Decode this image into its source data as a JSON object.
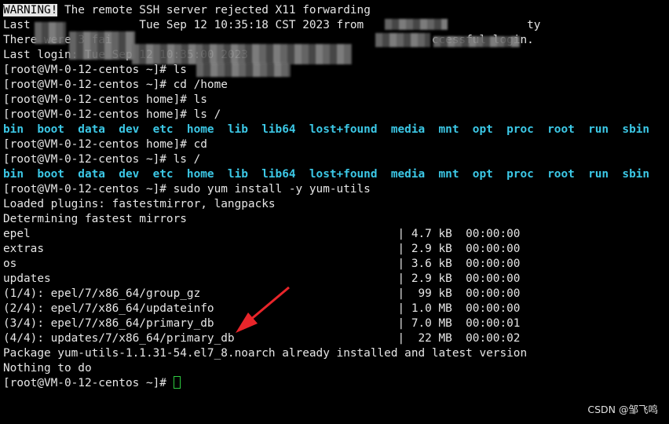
{
  "terminal": {
    "lines": [
      {
        "segments": [
          {
            "text": "WARNING!",
            "style": "warn"
          },
          {
            "text": " The remote SSH server rejected X11 forwarding",
            "style": "plain"
          }
        ]
      },
      {
        "segments": [
          {
            "text": "Last                Tue Sep 12 10:35:18 CST 2023 from                        ty",
            "style": "plain"
          }
        ]
      },
      {
        "segments": [
          {
            "text": "There were 3 fai                                               ccessful login.",
            "style": "plain"
          }
        ]
      },
      {
        "segments": [
          {
            "text": "Last login: Tue Sep 12 10:35:00 2023",
            "style": "plain"
          }
        ]
      },
      {
        "segments": [
          {
            "text": "[root@VM-0-12-centos ~]# ls",
            "style": "plain"
          }
        ]
      },
      {
        "segments": [
          {
            "text": "[root@VM-0-12-centos ~]# cd /home",
            "style": "plain"
          }
        ]
      },
      {
        "segments": [
          {
            "text": "[root@VM-0-12-centos home]# ls",
            "style": "plain"
          }
        ]
      },
      {
        "segments": [
          {
            "text": "[root@VM-0-12-centos home]# ls /",
            "style": "plain"
          }
        ]
      },
      {
        "segments": [
          {
            "text": "bin  boot  data  dev  etc  home  lib  lib64  lost+found  media  mnt  opt  proc  root  run  sbin",
            "style": "dir"
          }
        ]
      },
      {
        "segments": [
          {
            "text": "[root@VM-0-12-centos home]# cd",
            "style": "plain"
          }
        ]
      },
      {
        "segments": [
          {
            "text": "[root@VM-0-12-centos ~]# ls /",
            "style": "plain"
          }
        ]
      },
      {
        "segments": [
          {
            "text": "bin  boot  data  dev  etc  home  lib  lib64  lost+found  media  mnt  opt  proc  root  run  sbin",
            "style": "dir"
          }
        ]
      },
      {
        "segments": [
          {
            "text": "[root@VM-0-12-centos ~]# sudo yum install -y yum-utils",
            "style": "plain"
          }
        ]
      },
      {
        "segments": [
          {
            "text": "Loaded plugins: fastestmirror, langpacks",
            "style": "plain"
          }
        ]
      },
      {
        "segments": [
          {
            "text": "Determining fastest mirrors",
            "style": "plain"
          }
        ]
      },
      {
        "segments": [
          {
            "text": "epel                                                      | 4.7 kB  00:00:00",
            "style": "plain"
          }
        ]
      },
      {
        "segments": [
          {
            "text": "extras                                                    | 2.9 kB  00:00:00",
            "style": "plain"
          }
        ]
      },
      {
        "segments": [
          {
            "text": "os                                                        | 3.6 kB  00:00:00",
            "style": "plain"
          }
        ]
      },
      {
        "segments": [
          {
            "text": "updates                                                   | 2.9 kB  00:00:00",
            "style": "plain"
          }
        ]
      },
      {
        "segments": [
          {
            "text": "(1/4): epel/7/x86_64/group_gz                             |  99 kB  00:00:00",
            "style": "plain"
          }
        ]
      },
      {
        "segments": [
          {
            "text": "(2/4): epel/7/x86_64/updateinfo                           | 1.0 MB  00:00:00",
            "style": "plain"
          }
        ]
      },
      {
        "segments": [
          {
            "text": "(3/4): epel/7/x86_64/primary_db                           | 7.0 MB  00:00:01",
            "style": "plain"
          }
        ]
      },
      {
        "segments": [
          {
            "text": "(4/4): updates/7/x86_64/primary_db                        |  22 MB  00:00:02",
            "style": "plain"
          }
        ]
      },
      {
        "segments": [
          {
            "text": "Package yum-utils-1.1.31-54.el7_8.noarch already installed and latest version",
            "style": "plain"
          }
        ]
      },
      {
        "segments": [
          {
            "text": "Nothing to do",
            "style": "plain"
          }
        ]
      },
      {
        "segments": [
          {
            "text": "[root@VM-0-12-centos ~]# ",
            "style": "plain"
          },
          {
            "text": "",
            "style": "cursor"
          }
        ]
      }
    ]
  },
  "watermark": "CSDN @邹飞鸣",
  "colors": {
    "background": "#000000",
    "text": "#e6e6e6",
    "directory": "#3cc8e6",
    "cursor": "#2ecc40",
    "annotation_arrow": "#e8252a"
  }
}
